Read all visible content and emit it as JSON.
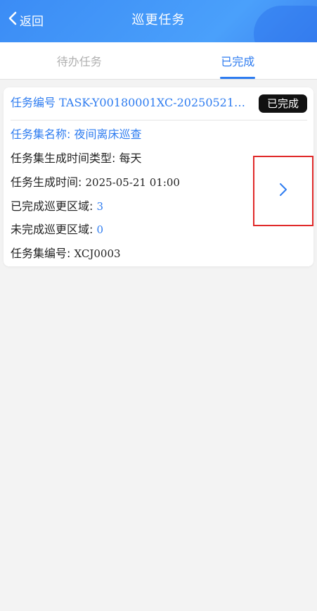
{
  "header": {
    "back_label": "返回",
    "title": "巡更任务"
  },
  "tabs": [
    {
      "label": "待办任务",
      "active": false
    },
    {
      "label": "已完成",
      "active": true
    }
  ],
  "task": {
    "number_prefix": "任务编号 ",
    "number_value": "TASK-Y00180001XC-20250521-00...",
    "status_badge": "已完成",
    "set_name_label": "任务集名称: ",
    "set_name_value": "夜间离床巡查",
    "gen_type_label": "任务集生成时间类型: ",
    "gen_type_value": "每天",
    "gen_time_label": "任务生成时间: ",
    "gen_time_value": "2025-05-21 01:00",
    "done_area_label": "已完成巡更区域: ",
    "done_area_value": "3",
    "undone_area_label": "未完成巡更区域: ",
    "undone_area_value": "0",
    "set_no_label": "任务集编号: ",
    "set_no_value": "XCJ0003"
  },
  "colors": {
    "accent": "#2e7cf0",
    "header_bg": "#4aa0fb",
    "highlight_border": "#e02a2a"
  }
}
